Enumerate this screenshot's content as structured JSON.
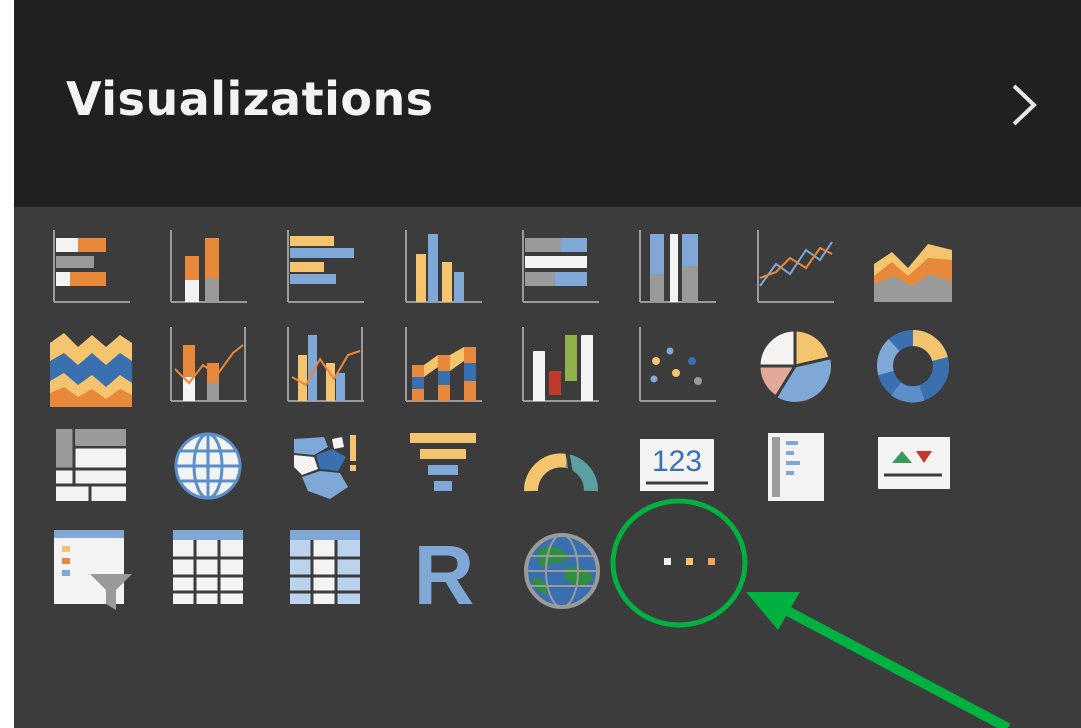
{
  "pane": {
    "title": "Visualizations",
    "expand_icon": "chevron-right-icon"
  },
  "visuals": [
    {
      "name": "stacked-bar-chart-icon"
    },
    {
      "name": "stacked-column-chart-icon"
    },
    {
      "name": "clustered-bar-chart-icon"
    },
    {
      "name": "clustered-column-chart-icon"
    },
    {
      "name": "100-stacked-bar-chart-icon"
    },
    {
      "name": "100-stacked-column-chart-icon"
    },
    {
      "name": "line-chart-icon"
    },
    {
      "name": "area-chart-icon"
    },
    {
      "name": "stacked-area-chart-icon"
    },
    {
      "name": "line-and-stacked-column-chart-icon"
    },
    {
      "name": "line-and-clustered-column-chart-icon"
    },
    {
      "name": "ribbon-chart-icon"
    },
    {
      "name": "waterfall-chart-icon"
    },
    {
      "name": "scatter-chart-icon"
    },
    {
      "name": "pie-chart-icon"
    },
    {
      "name": "donut-chart-icon"
    },
    {
      "name": "treemap-icon"
    },
    {
      "name": "map-icon"
    },
    {
      "name": "filled-map-icon"
    },
    {
      "name": "funnel-icon"
    },
    {
      "name": "gauge-icon"
    },
    {
      "name": "card-icon"
    },
    {
      "name": "multi-row-card-icon"
    },
    {
      "name": "kpi-icon"
    },
    {
      "name": "slicer-icon"
    },
    {
      "name": "table-icon"
    },
    {
      "name": "matrix-icon"
    },
    {
      "name": "r-script-visual-icon"
    },
    {
      "name": "arcgis-map-icon"
    },
    {
      "name": "more-visuals-ellipsis-icon"
    }
  ],
  "card_text": "123",
  "r_letter": "R",
  "colors": {
    "header_bg": "#202020",
    "pane_bg": "#3c3c3c",
    "orange": "#e8883a",
    "yellow": "#f4c46e",
    "blue": "#7fa8d7",
    "gray": "#9a9a9a",
    "annotation_green": "#00b140"
  }
}
